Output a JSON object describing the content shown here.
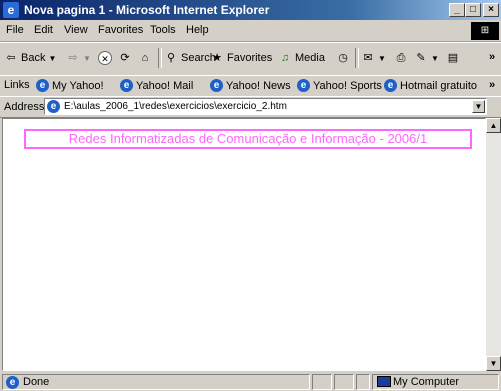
{
  "window": {
    "title": "Nova pagina 1 - Microsoft Internet Explorer",
    "icon": "ie-icon",
    "buttons": {
      "minimize": "_",
      "maximize": "□",
      "close": "×"
    }
  },
  "menu": [
    {
      "label": "File"
    },
    {
      "label": "Edit"
    },
    {
      "label": "View"
    },
    {
      "label": "Favorites"
    },
    {
      "label": "Tools"
    },
    {
      "label": "Help"
    }
  ],
  "toolbar": {
    "back": "Back",
    "search": "Search",
    "favorites": "Favorites",
    "media": "Media"
  },
  "links": {
    "label": "Links",
    "items": [
      "My Yahoo!",
      "Yahoo! Mail",
      "Yahoo! News",
      "Yahoo! Sports",
      "Hotmail gratuito"
    ]
  },
  "address": {
    "label": "Address",
    "value": "E:\\aulas_2006_1\\redes\\exercicios\\exercicio_2.htm"
  },
  "content": {
    "heading": "Redes Informatizadas de Comunicação e Informação - 2006/1",
    "heading_color": "#ff66ff"
  },
  "status": {
    "text": "Done",
    "zone": "My Computer"
  }
}
